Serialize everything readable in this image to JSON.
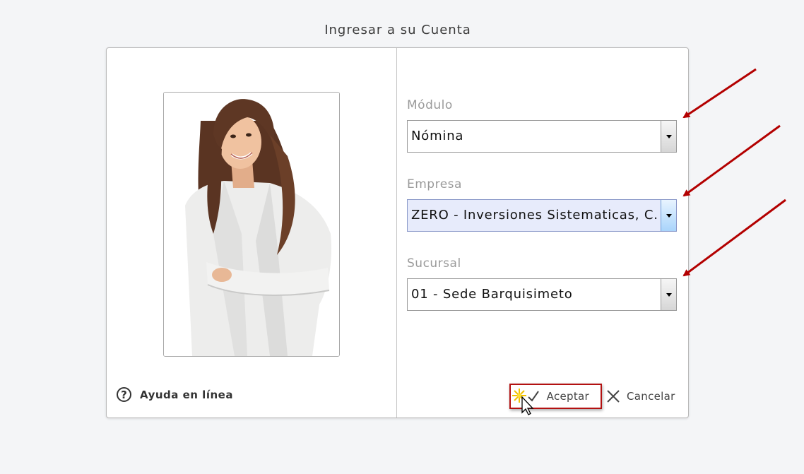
{
  "dialog": {
    "title": "Ingresar a su Cuenta"
  },
  "left": {
    "photo_alt": "user-photo",
    "help": {
      "icon": "help-circle-icon",
      "label": "Ayuda en línea"
    }
  },
  "form": {
    "modulo": {
      "label": "Módulo",
      "value": "Nómina"
    },
    "empresa": {
      "label": "Empresa",
      "value": "ZERO - Inversiones Sistematicas, C.A."
    },
    "sucursal": {
      "label": "Sucursal",
      "value": "01 - Sede Barquisimeto"
    }
  },
  "actions": {
    "accept": {
      "label": "Aceptar",
      "icon": "check-icon"
    },
    "cancel": {
      "label": "Cancelar",
      "icon": "close-icon"
    }
  },
  "colors": {
    "annotation_red": "#b30000",
    "focus_bg": "#e7ebfb",
    "accept_border": "#b31111"
  }
}
